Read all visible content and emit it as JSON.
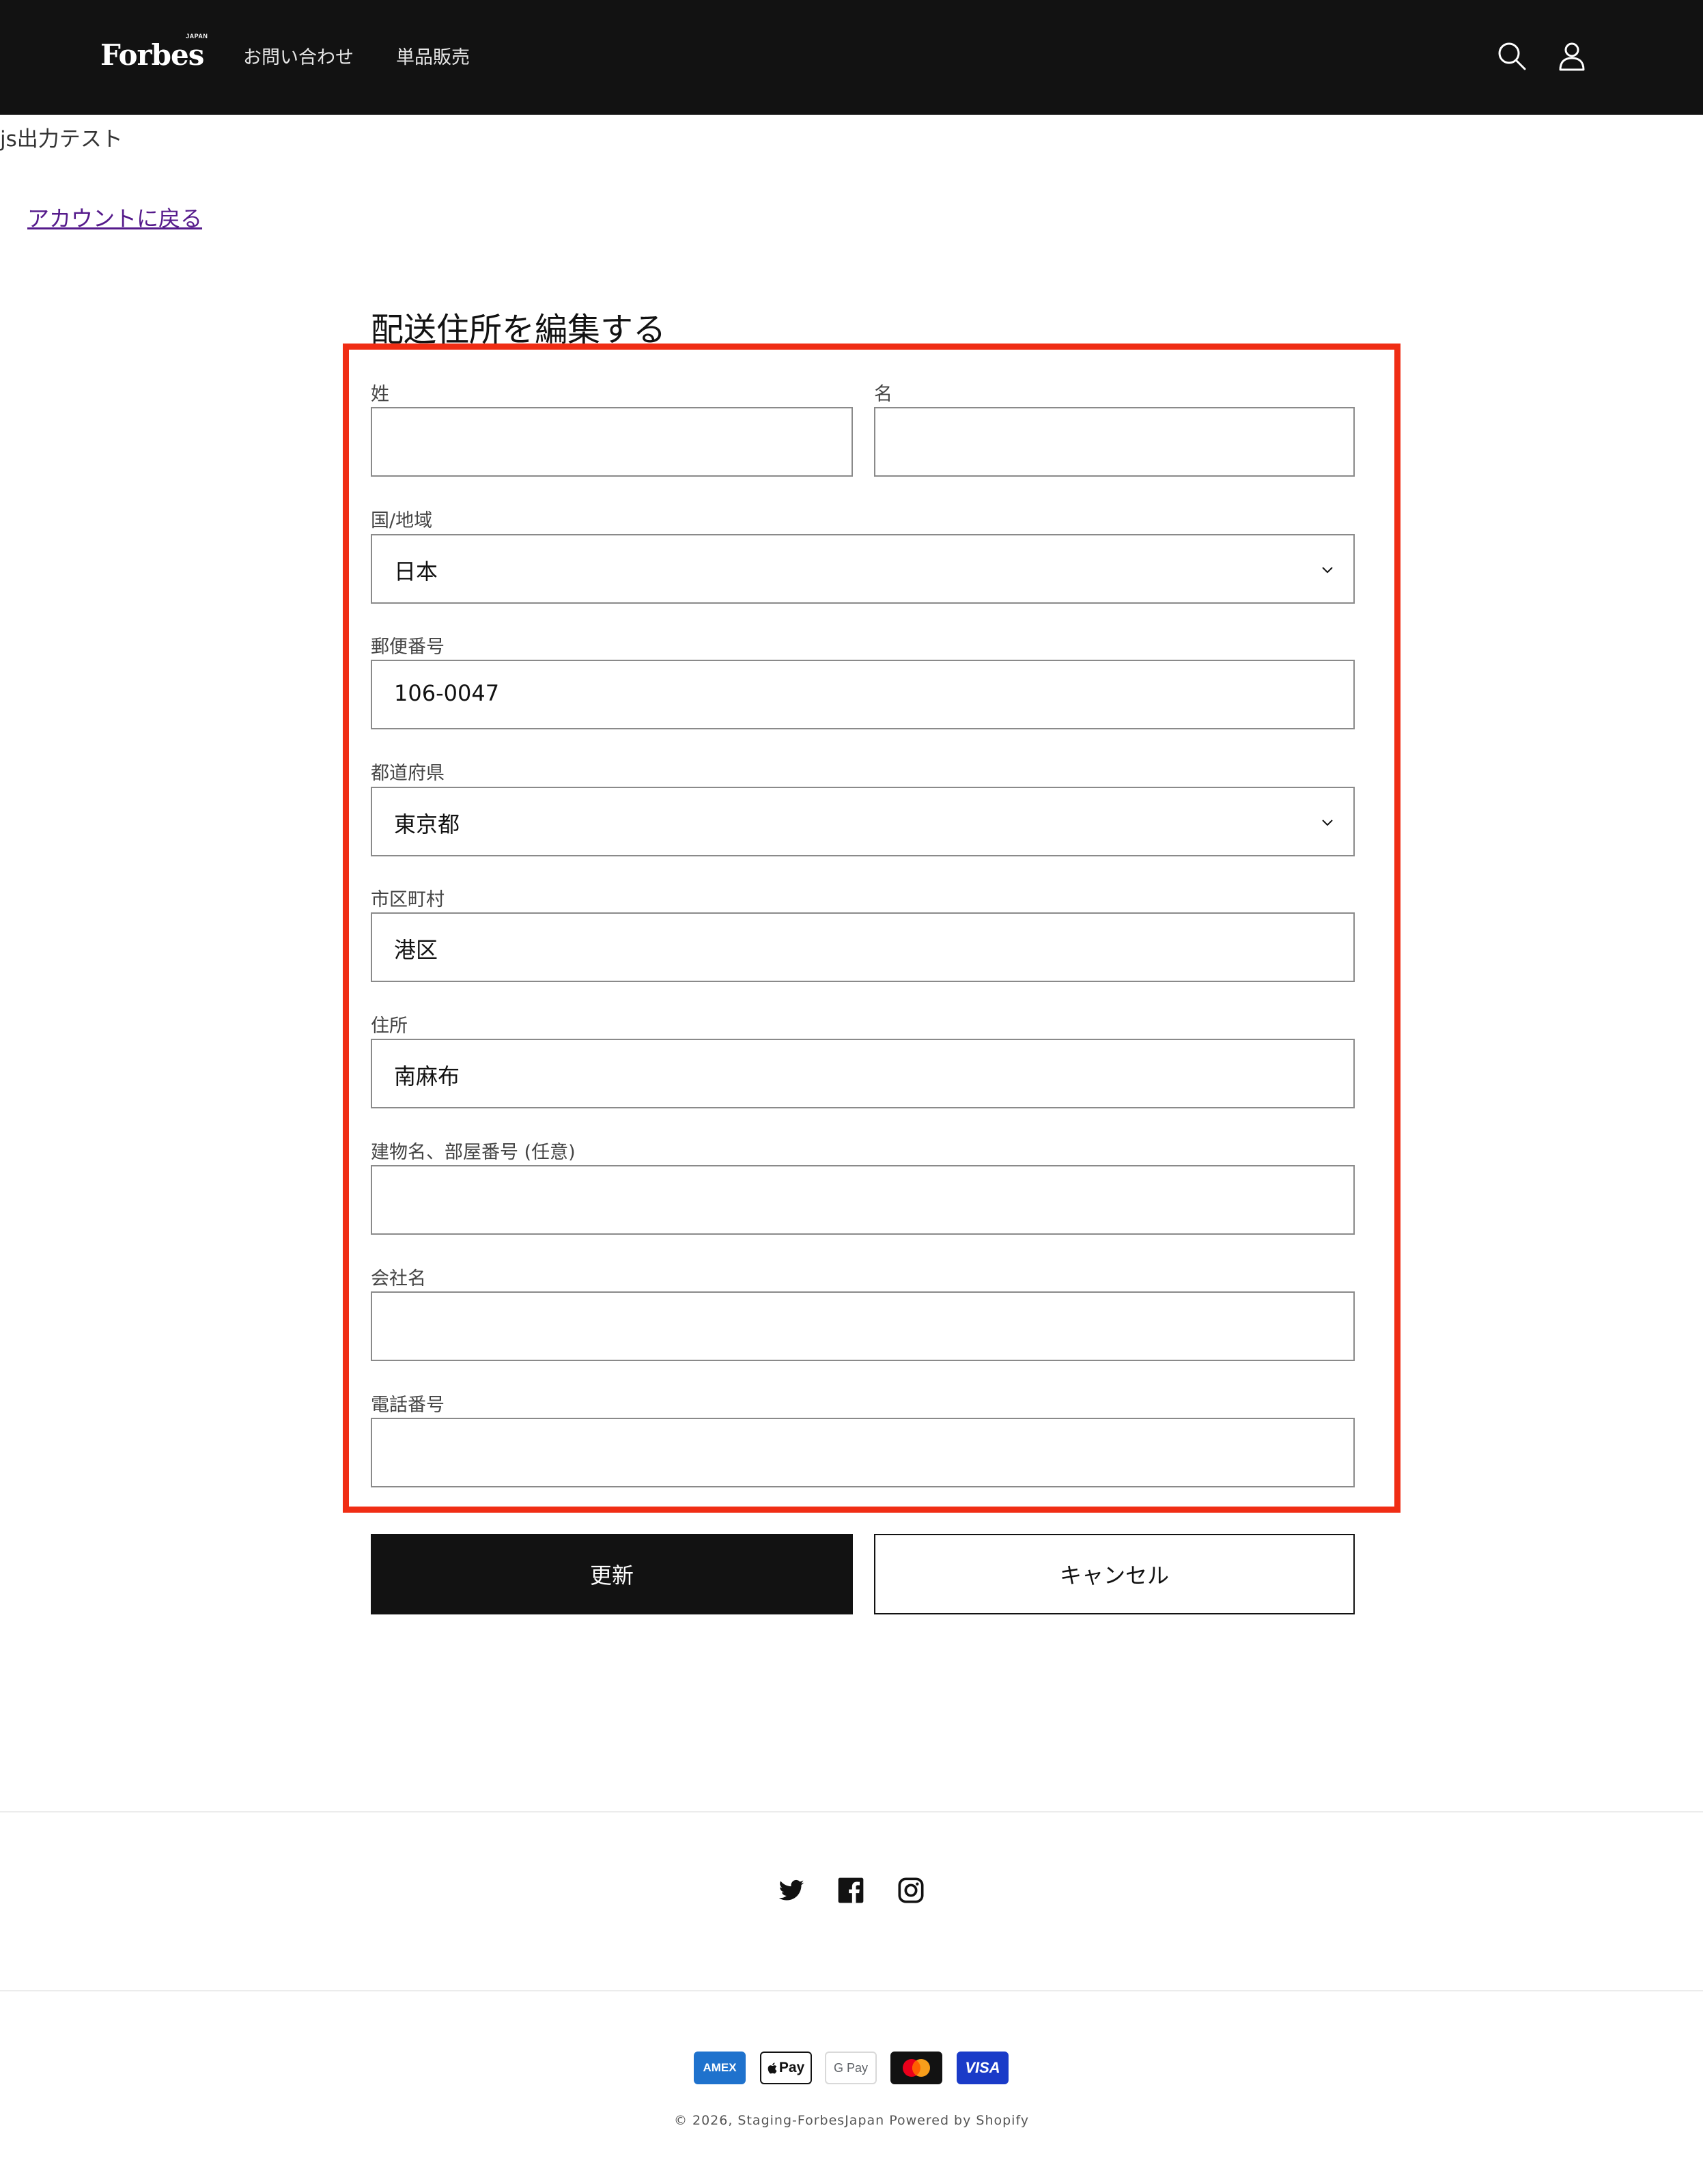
{
  "header": {
    "logo_text": "Forbes",
    "logo_sup": "JAPAN",
    "nav": [
      {
        "label": "お問い合わせ"
      },
      {
        "label": "単品販売"
      }
    ],
    "icons": [
      "search-icon",
      "account-icon"
    ]
  },
  "debug_text": "js出力テスト",
  "back_link": "アカウントに戻る",
  "form": {
    "title": "配送住所を編集する",
    "last_name_label": "姓",
    "last_name_value": "",
    "first_name_label": "名",
    "first_name_value": "",
    "country_label": "国/地域",
    "country_value": "日本",
    "postal_label": "郵便番号",
    "postal_value": "106-0047",
    "prefecture_label": "都道府県",
    "prefecture_value": "東京都",
    "city_label": "市区町村",
    "city_value": "港区",
    "address_label": "住所",
    "address_value": "南麻布",
    "building_label": "建物名、部屋番号 (任意)",
    "building_value": "",
    "company_label": "会社名",
    "company_value": "",
    "phone_label": "電話番号",
    "phone_value": "",
    "update_label": "更新",
    "cancel_label": "キャンセル",
    "highlight_color": "#f02d14"
  },
  "footer": {
    "social": [
      "twitter-icon",
      "facebook-icon",
      "instagram-icon"
    ],
    "payments": [
      {
        "name": "amex-icon",
        "text": "AMEX"
      },
      {
        "name": "apple-pay-icon",
        "text": "Pay"
      },
      {
        "name": "google-pay-icon",
        "text": "G Pay"
      },
      {
        "name": "mastercard-icon",
        "text": ""
      },
      {
        "name": "visa-icon",
        "text": "VISA"
      }
    ],
    "copyright": "© 2026, Staging-ForbesJapan Powered by Shopify"
  }
}
